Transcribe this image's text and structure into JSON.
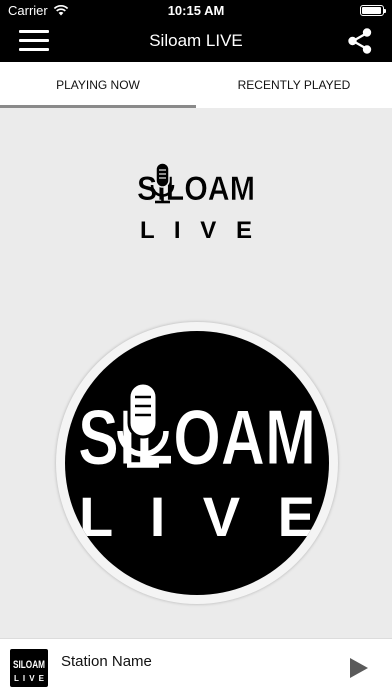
{
  "status_bar": {
    "carrier": "Carrier",
    "time": "10:15 AM",
    "battery_level": 0.95
  },
  "nav": {
    "title": "Siloam LIVE"
  },
  "tabs": [
    {
      "label": "PLAYING NOW",
      "active": true
    },
    {
      "label": "RECENTLY PLAYED",
      "active": false
    }
  ],
  "logo": {
    "line1": "SILOAM",
    "line2": "L I V E"
  },
  "player": {
    "station_name": "Station Name"
  },
  "colors": {
    "bar": "#000000",
    "background": "#ebebeb",
    "tab_indicator": "#8a8a8a"
  },
  "icons": {
    "menu": "hamburger-icon",
    "share": "share-icon",
    "play": "play-icon",
    "wifi": "wifi-icon",
    "battery": "battery-icon",
    "microphone": "microphone-icon"
  }
}
